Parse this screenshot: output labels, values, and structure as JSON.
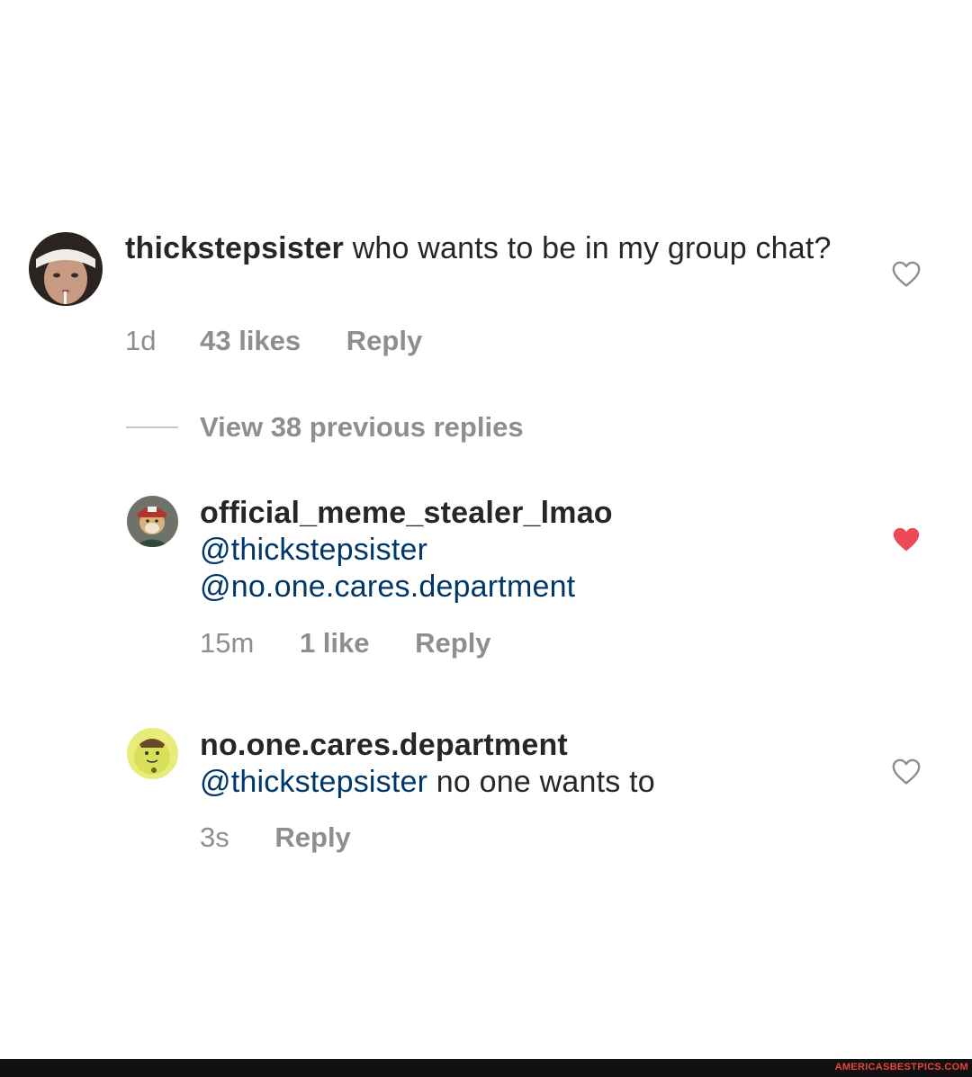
{
  "comments": [
    {
      "username": "thickstepsister",
      "text": " who wants to be in my group chat?",
      "time": "1d",
      "likes": "43 likes",
      "reply": "Reply",
      "liked": false
    },
    {
      "username": "official_meme_stealer_lmao",
      "mention1": "@thickstepsister",
      "mention2": "@no.one.cares.department",
      "time": "15m",
      "likes": "1 like",
      "reply": "Reply",
      "liked": true
    },
    {
      "username": "no.one.cares.department",
      "mention": "@thickstepsister",
      "text": " no one wants to",
      "time": "3s",
      "reply": "Reply",
      "liked": false
    }
  ],
  "view_replies": "View 38 previous replies",
  "watermark": "AMERICASBESTPICS.COM",
  "icons": {
    "heart_outline": "heart-outline-icon",
    "heart_filled": "heart-filled-icon"
  },
  "colors": {
    "mention": "#00376b",
    "meta": "#8e8e8e",
    "liked_heart": "#ed4956",
    "watermark": "#e8443a"
  }
}
